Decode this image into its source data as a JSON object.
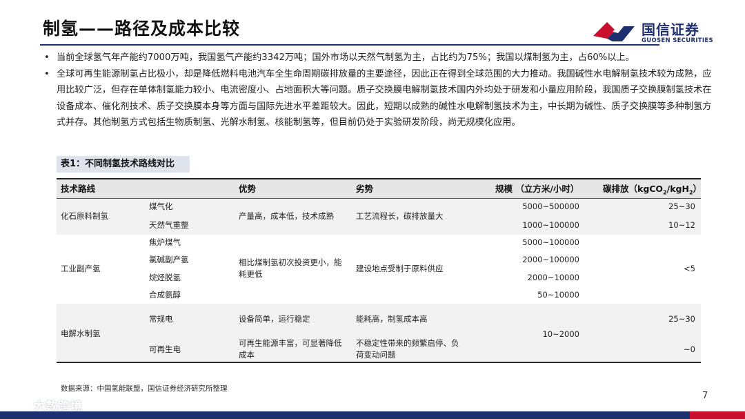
{
  "page": {
    "title": "制氢——路径及成本比较",
    "page_number": "7",
    "source": "数据来源：中国氢能联盟，国信证券经济研究所整理"
  },
  "logo": {
    "cn": "国信证券",
    "en": "GUOSEN SECURITIES",
    "colors": {
      "navy": "#1d2f6f",
      "red": "#c8102e"
    }
  },
  "watermark": {
    "text": "大数跨境"
  },
  "bullets": [
    "当前全球氢气年产能约7000万吨，我国氢气产能约3342万吨；国外市场以天然气制氢为主，占比约为75%；我国以煤制氢为主，占60%以上。",
    "全球可再生能源制氢占比极小，却是降低燃料电池汽车全生命周期碳排放量的主要途径，因此正在得到全球范围的大力推动。我国碱性水电解制氢技术较为成熟，应用比较广泛，但存在单体制氢能力较小、电流密度小、占地面积大等问题。质子交换膜电解制氢技术国内外均处于研发和小量应用阶段，我国质子交换膜制氢技术在设备成本、催化剂技术、质子交换膜本身等方面与国际先进水平差距较大。因此，短期以成熟的碱性水电解制氢技术为主，中长期为碱性、质子交换膜等多种制氢方式并存。其他制氢方式包括生物质制氢、光解水制氢、核能制氢等，但目前仍处于实验研发阶段，尚无规模化应用。"
  ],
  "table": {
    "caption": "表1：不同制氢技术路线对比",
    "headers": {
      "route": "技术路线",
      "advantage": "优势",
      "disadvantage": "劣势",
      "scale": "规模 （立方米/小时）",
      "emission_prefix": "碳排放（kgCO",
      "emission_sub1": "2",
      "emission_mid": "/kgH",
      "emission_sub2": "2",
      "emission_suffix": "）"
    },
    "groups": [
      {
        "route": "化石原料制氢",
        "subs": [
          "煤气化",
          "天然气重整"
        ],
        "advantage": "产量高，成本低，技术成熟",
        "disadvantage": "工艺流程长，碳排放量大",
        "scales": [
          "5000~500000",
          "1000~100000"
        ],
        "emissions": [
          "25~30",
          "10~12"
        ]
      },
      {
        "route": "工业副产氢",
        "subs": [
          "焦炉煤气",
          "氯碱副产氢",
          "烷烃脱氢",
          "合成氨醇"
        ],
        "advantage": "相比煤制氢初次投资更小，能耗更低",
        "disadvantage": "建设地点受制于原料供应",
        "scales": [
          "5000~100000",
          "2000~100000",
          "2000~10000",
          "50~10000"
        ],
        "emission": "<5"
      },
      {
        "route": "电解水制氢",
        "subs": [
          "常规电",
          "可再生电"
        ],
        "advantages": [
          "设备简单，运行稳定",
          "可再生能源丰富，可显著降低成本"
        ],
        "disadvantages": [
          "能耗高，制氢成本高",
          "不稳定性带来的频繁启停、负荷变动问题"
        ],
        "scale": "10~2000",
        "emissions": [
          "25~30",
          "~0"
        ]
      }
    ]
  }
}
